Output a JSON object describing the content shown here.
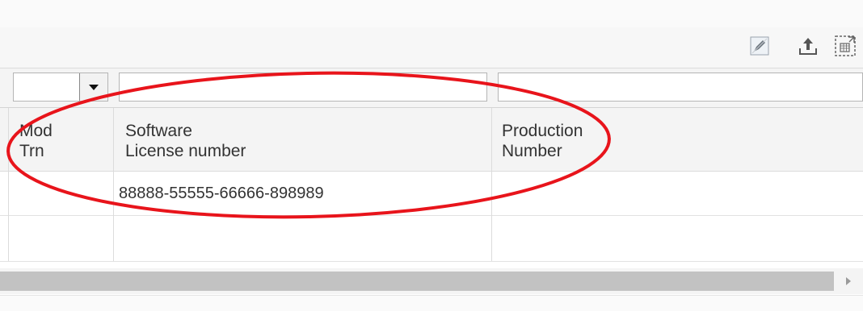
{
  "toolbar": {
    "icons": [
      "edit-icon",
      "upload-icon",
      "fullscreen-icon"
    ]
  },
  "filters": {
    "mod_trn_select": {
      "value": ""
    },
    "software_license_filter": {
      "value": "",
      "placeholder": ""
    },
    "production_number_filter": {
      "value": "",
      "placeholder": ""
    }
  },
  "table": {
    "columns": [
      {
        "line1": "Mod",
        "line2": "Trn"
      },
      {
        "line1": "Software",
        "line2": "License number"
      },
      {
        "line1": "Production",
        "line2": "Number"
      }
    ],
    "rows": [
      {
        "mod_trn": "",
        "license_number": "88888-55555-66666-898989",
        "production_number": ""
      },
      {
        "mod_trn": "",
        "license_number": "",
        "production_number": ""
      }
    ]
  },
  "scrollbar": {
    "arrow_icon": "chevron-right-icon"
  },
  "annotation": {
    "color": "#e8141b",
    "shape": "ellipse"
  }
}
